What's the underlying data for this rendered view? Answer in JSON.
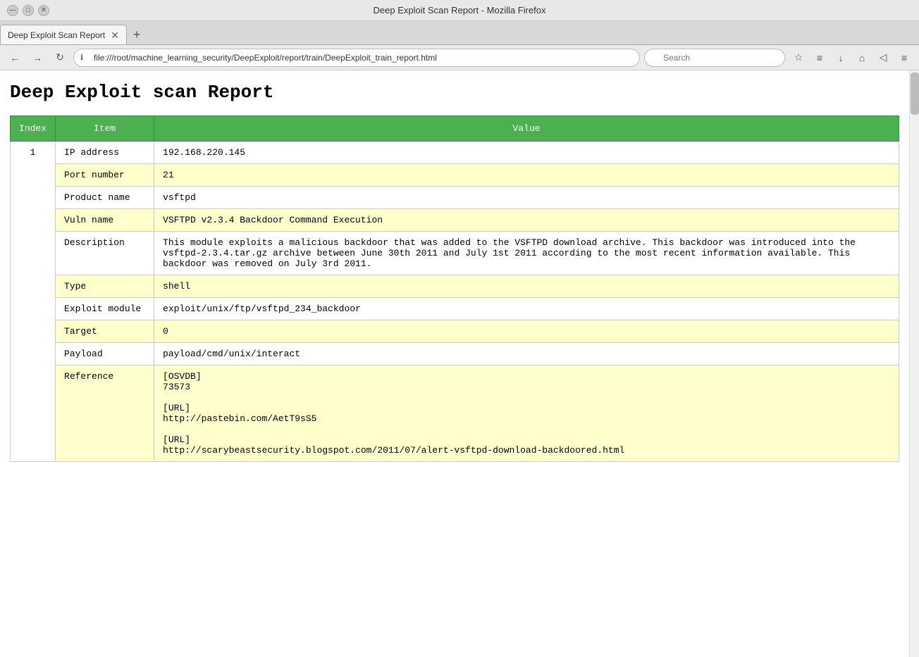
{
  "window": {
    "title": "Deep Exploit Scan Report - Mozilla Firefox",
    "controls": {
      "minimize": "—",
      "maximize": "□",
      "close": "✕"
    }
  },
  "tab": {
    "label": "Deep Exploit Scan Report",
    "close": "✕",
    "new_tab": "+"
  },
  "address_bar": {
    "back": "←",
    "forward": "→",
    "reload": "↻",
    "url": "file:///root/machine_learning_security/DeepExploit/report/train/DeepExploit_train_report.html",
    "search_placeholder": "Search",
    "lock_icon": "ℹ",
    "star_icon": "☆",
    "reader_icon": "≡",
    "download_icon": "↓",
    "home_icon": "⌂",
    "pocket_icon": "◁",
    "menu_icon": "≡"
  },
  "page": {
    "title": "Deep Exploit scan Report",
    "table": {
      "headers": [
        "Index",
        "Item",
        "Value"
      ],
      "rows": [
        {
          "index": "",
          "item": "IP address",
          "value": "192.168.220.145",
          "highlight": false
        },
        {
          "index": "",
          "item": "Port number",
          "value": "21",
          "highlight": true
        },
        {
          "index": "",
          "item": "Product name",
          "value": "vsftpd",
          "highlight": false
        },
        {
          "index": "",
          "item": "Vuln name",
          "value": "VSFTPD v2.3.4 Backdoor Command Execution",
          "highlight": true
        },
        {
          "index": "",
          "item": "Description",
          "value": "This module exploits a malicious backdoor that was added to the VSFTPD download archive. This backdoor was introduced into the vsftpd-2.3.4.tar.gz archive between June 30th 2011 and July 1st 2011 according to the most recent information available. This backdoor was removed on July 3rd 2011.",
          "highlight": false
        },
        {
          "index": "",
          "item": "Type",
          "value": "shell",
          "highlight": true
        },
        {
          "index": "1",
          "item": "Exploit module",
          "value": "exploit/unix/ftp/vsftpd_234_backdoor",
          "highlight": false
        },
        {
          "index": "",
          "item": "Target",
          "value": "0",
          "highlight": true
        },
        {
          "index": "",
          "item": "Payload",
          "value": "payload/cmd/unix/interact",
          "highlight": false
        },
        {
          "index": "",
          "item": "Reference",
          "value": "[OSVDB]\n73573\n\n[URL]\nhttp://pastebin.com/AetT9sS5\n\n[URL]\nhttp://scarybeastsecurity.blogspot.com/2011/07/alert-vsftpd-download-backdoored.html",
          "highlight": true
        }
      ]
    }
  }
}
